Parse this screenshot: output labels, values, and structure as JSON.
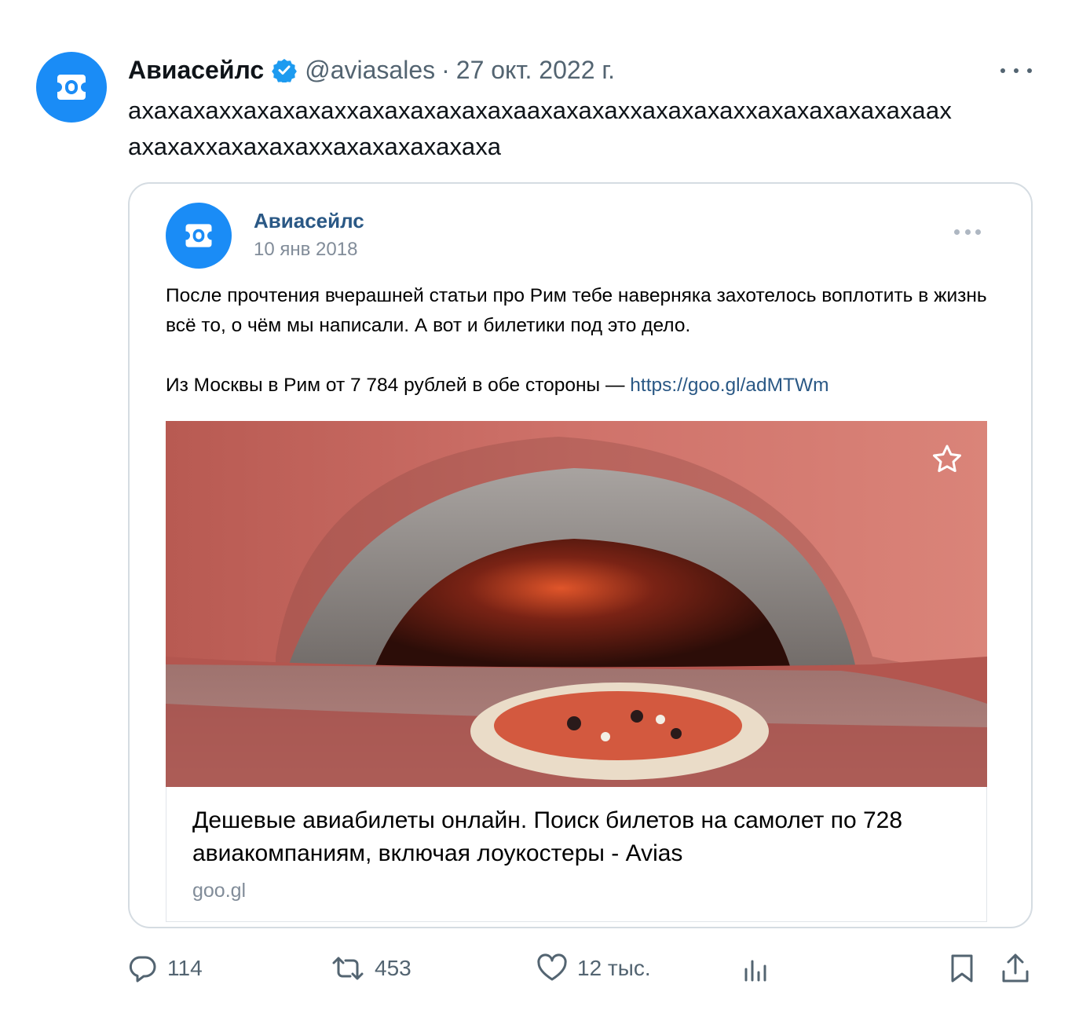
{
  "tweet": {
    "author_name": "Авиасейлс",
    "handle": "@aviasales",
    "separator": "·",
    "date": "27 окт. 2022 г.",
    "text": "ахахахаххахахахаххахахахахахахаахахахаххахахахаххахахахахахахаах ахахаххахахахаххахахахахахаха"
  },
  "embedded_post": {
    "author_name": "Авиасейлс",
    "date": "10 янв 2018",
    "text_paragraph_1": "После прочтения вчерашней статьи про Рим тебе наверняка захотелось воплотить в жизнь всё то, о чём мы написали. А вот и билетики под это дело.",
    "text_paragraph_2_prefix": "Из Москвы в Рим от 7 784 рублей в обе стороны — ",
    "link_url": "https://goo.gl/adMTWm",
    "link_card": {
      "title": "Дешевые авиабилеты онлайн. Поиск билетов на самолет по 728 авиакомпаниям, включая лоукостеры - Avias",
      "domain": "goo.gl"
    }
  },
  "actions": {
    "replies": "114",
    "reposts": "453",
    "likes": "12 тыс."
  },
  "colors": {
    "brand_blue": "#1a8cf6",
    "vk_link": "#2a5885",
    "muted": "#536471"
  }
}
